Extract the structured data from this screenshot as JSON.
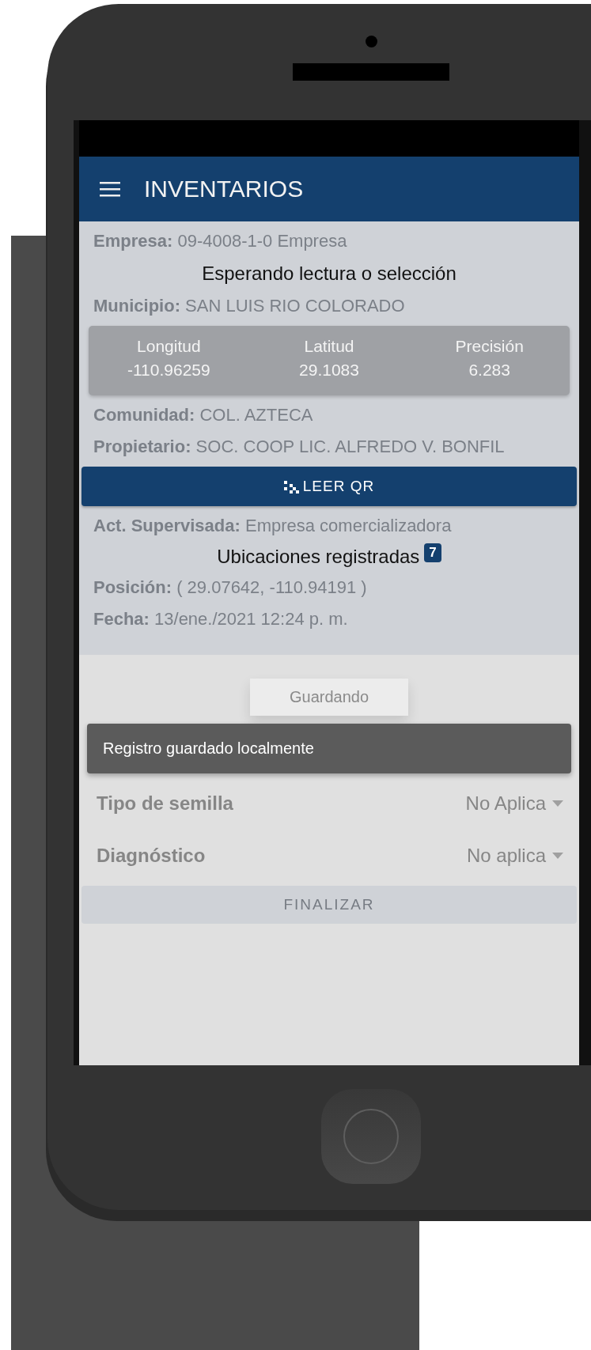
{
  "header": {
    "title": "INVENTARIOS"
  },
  "record": [
    {
      "label": "Empresa:",
      "value": "09-4008-1-0 Empresa"
    },
    {
      "label": "Municipio:",
      "value": "SAN LUIS RIO COLORADO"
    },
    {
      "label": "Comunidad:",
      "value": "COL. AZTECA"
    },
    {
      "label": "Propietario:",
      "value": "SOC. COOP LIC. ALFREDO V. BONFIL"
    },
    {
      "label": "Act. Supervisada:",
      "value": "Empresa comercializadora"
    },
    {
      "label": "Posición:",
      "value": "( 29.07642, -110.94191 )"
    },
    {
      "label": "Fecha:",
      "value": "13/ene./2021 12:24 p. m."
    }
  ],
  "scanner": {
    "status": "Esperando lectura o selección",
    "gps": [
      {
        "label": "Longitud",
        "value": "-110.96259"
      },
      {
        "label": "Latitud",
        "value": "29.1083"
      },
      {
        "label": "Precisión",
        "value": "6.283"
      }
    ],
    "scan_button": "LEER QR",
    "locations_label": "Ubicaciones registradas",
    "locations_count": "7"
  },
  "saving_dialog": {
    "text": "Guardando"
  },
  "snackbar": "Registro guardado localmente",
  "fields": [
    {
      "label": "Tipo de semilla",
      "value": "No Aplica"
    },
    {
      "label": "Diagnóstico",
      "value": "No aplica"
    }
  ],
  "finish_button": {
    "label": "FINALIZAR",
    "disabled": true
  }
}
